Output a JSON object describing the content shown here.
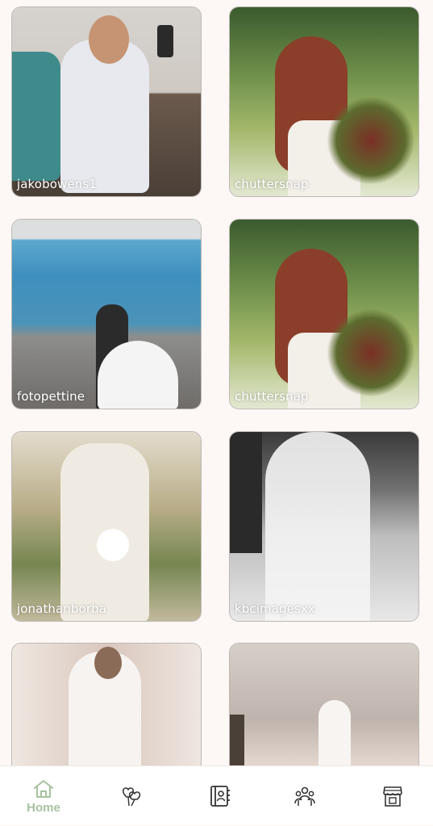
{
  "gallery": {
    "photos": [
      {
        "credit": "jakobowens1"
      },
      {
        "credit": "chuttersnap"
      },
      {
        "credit": "fotopettine"
      },
      {
        "credit": "chuttersnap"
      },
      {
        "credit": "jonathanborba"
      },
      {
        "credit": "kbcimagesxx"
      },
      {
        "credit": ""
      },
      {
        "credit": ""
      }
    ]
  },
  "tabbar": {
    "active_color": "#a7c2a0",
    "inactive_color": "#333333",
    "items": [
      {
        "icon": "home-icon",
        "label": "Home"
      },
      {
        "icon": "hearts-balloon-icon",
        "label": ""
      },
      {
        "icon": "contact-book-icon",
        "label": ""
      },
      {
        "icon": "group-icon",
        "label": ""
      },
      {
        "icon": "storefront-icon",
        "label": ""
      }
    ]
  }
}
